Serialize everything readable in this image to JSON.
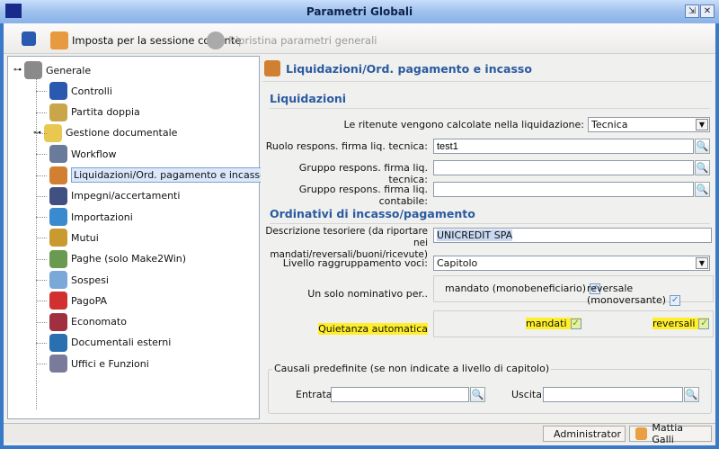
{
  "window": {
    "title": "Parametri Globali",
    "minimize": "⇲",
    "close": "✕"
  },
  "toolbar": {
    "set_session": "Imposta per la sessione corrente",
    "restore": "Ripristina parametri generali"
  },
  "tree": [
    {
      "label": "Generale",
      "color": "#8a8a8a"
    },
    {
      "label": "Controlli",
      "color": "#2a5ab0"
    },
    {
      "label": "Partita doppia",
      "color": "#c9a64a"
    },
    {
      "label": "Gestione documentale",
      "color": "#e8c850"
    },
    {
      "label": "Workflow",
      "color": "#6a7a9a"
    },
    {
      "label": "Liquidazioni/Ord. pagamento e incasso",
      "color": "#d08030"
    },
    {
      "label": "Impegni/accertamenti",
      "color": "#405080"
    },
    {
      "label": "Importazioni",
      "color": "#3a8ad0"
    },
    {
      "label": "Mutui",
      "color": "#c89a30"
    },
    {
      "label": "Paghe (solo Make2Win)",
      "color": "#6a9a50"
    },
    {
      "label": "Sospesi",
      "color": "#7aa8d8"
    },
    {
      "label": "PagoPA",
      "color": "#d03030"
    },
    {
      "label": "Economato",
      "color": "#a03040"
    },
    {
      "label": "Documentali esterni",
      "color": "#2a70b0"
    },
    {
      "label": "Uffici e Funzioni",
      "color": "#7a7a9a"
    }
  ],
  "panel": {
    "title": "Liquidazioni/Ord. pagamento e incasso",
    "liquidazioni": {
      "heading": "Liquidazioni",
      "ritenute_label": "Le ritenute vengono calcolate nella liquidazione:",
      "ritenute_value": "Tecnica",
      "ruolo_label": "Ruolo respons. firma liq. tecnica:",
      "ruolo_value": "test1",
      "gruppo_tec_label": "Gruppo respons. firma liq. tecnica:",
      "gruppo_tec_value": "",
      "gruppo_cont_label": "Gruppo respons. firma liq. contabile:",
      "gruppo_cont_value": ""
    },
    "ordinativi": {
      "heading": "Ordinativi di incasso/pagamento",
      "desc_label_1": "Descrizione tesoriere (da riportare nei",
      "desc_label_2": "mandati/reversali/buoni/ricevute)",
      "desc_value": "UNICREDIT SPA",
      "livello_label": "Livello raggruppamento voci:",
      "livello_value": "Capitolo",
      "nominativo_label": "Un solo nominativo per..",
      "mandato_label": "mandato (monobeneficiario)",
      "mandato_checked": true,
      "reversale_label": "reversale (monoversante)",
      "reversale_checked": true,
      "quietanza_label": "Quietanza automatica",
      "q_mandati_label": "mandati",
      "q_mandati_checked": true,
      "q_reversali_label": "reversali",
      "q_reversali_checked": true
    },
    "causali": {
      "legend": "Causali predefinite (se non indicate a livello di capitolo)",
      "entrata_label": "Entrata",
      "entrata_value": "",
      "uscita_label": "Uscita",
      "uscita_value": ""
    }
  },
  "status": {
    "role": "Administrator",
    "user": "Mattia Galli"
  },
  "check": "✓"
}
